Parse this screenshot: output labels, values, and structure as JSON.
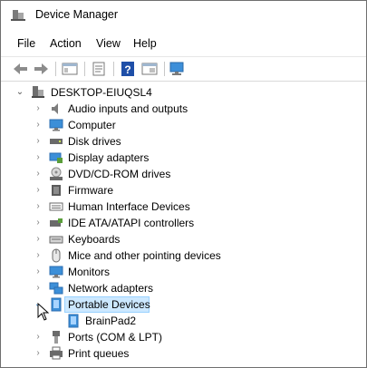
{
  "window": {
    "title": "Device Manager"
  },
  "menu": {
    "file": "File",
    "action": "Action",
    "view": "View",
    "help": "Help"
  },
  "toolbar": {
    "back": "back-arrow-icon",
    "forward": "forward-arrow-icon",
    "properties": "properties-icon",
    "update": "update-driver-icon",
    "help": "help-icon",
    "show": "show-hidden-icon",
    "scan": "scan-hardware-icon"
  },
  "tree": {
    "root": "DESKTOP-EIUQSL4",
    "items": [
      {
        "label": "Audio inputs and outputs"
      },
      {
        "label": "Computer"
      },
      {
        "label": "Disk drives"
      },
      {
        "label": "Display adapters"
      },
      {
        "label": "DVD/CD-ROM drives"
      },
      {
        "label": "Firmware"
      },
      {
        "label": "Human Interface Devices"
      },
      {
        "label": "IDE ATA/ATAPI controllers"
      },
      {
        "label": "Keyboards"
      },
      {
        "label": "Mice and other pointing devices"
      },
      {
        "label": "Monitors"
      },
      {
        "label": "Network adapters"
      },
      {
        "label": "Portable Devices"
      },
      {
        "label": "Ports (COM & LPT)"
      },
      {
        "label": "Print queues"
      }
    ],
    "portable_child": "BrainPad2",
    "selected_color": "#cce8ff"
  }
}
